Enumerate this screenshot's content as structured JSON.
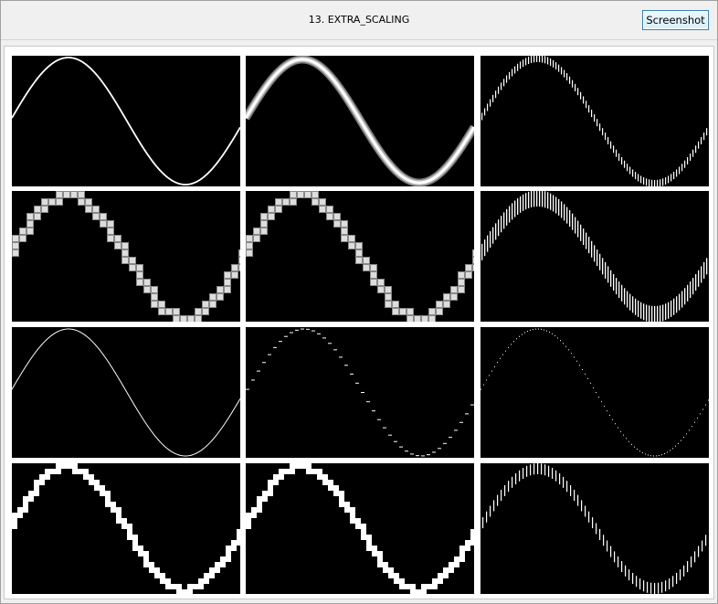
{
  "window": {
    "title": "13. EXTRA_SCALING",
    "screenshot_label": "Screenshot"
  },
  "panels": [
    {
      "name": "panel-smooth-thin"
    },
    {
      "name": "panel-smooth-thick-blurred"
    },
    {
      "name": "panel-sampled-striped"
    },
    {
      "name": "panel-blocky-blurred"
    },
    {
      "name": "panel-blocky-blurred-2"
    },
    {
      "name": "panel-sampled-striped-thick"
    },
    {
      "name": "panel-aliased-thin"
    },
    {
      "name": "panel-aliased-dashed"
    },
    {
      "name": "panel-aliased-dotted"
    },
    {
      "name": "panel-blocky-pixelated"
    },
    {
      "name": "panel-blocky-pixelated-2"
    },
    {
      "name": "panel-sampled-bars"
    }
  ]
}
